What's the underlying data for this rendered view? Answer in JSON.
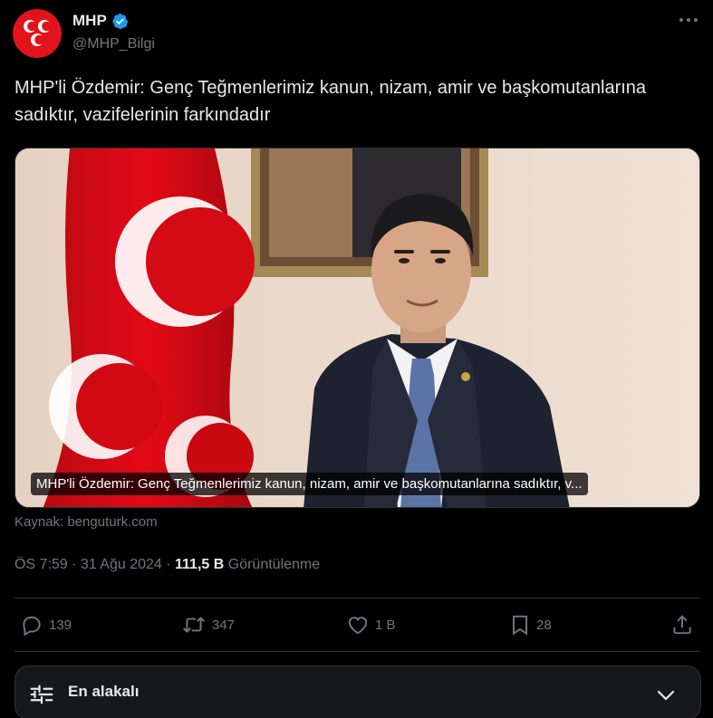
{
  "author": {
    "name": "MHP",
    "handle": "@MHP_Bilgi",
    "verified": true,
    "avatar_icon": "mhp-logo-icon",
    "brand_color": "#e3131b"
  },
  "tweet": {
    "text": "MHP'li Özdemir: Genç Teğmenlerimiz kanun, nizam, amir ve başkomutanlarına sadıktır, vazifelerinin farkındadır",
    "media_caption": "MHP'li Özdemir: Genç Teğmenlerimiz kanun, nizam, amir ve başkomutanlarına sadıktır, v...",
    "source": "Kaynak: benguturk.com",
    "time": "ÖS 7:59",
    "separator": " · ",
    "date": "31 Ağu 2024",
    "views_count": "111,5 B",
    "views_label": "Görüntülenme"
  },
  "actions": {
    "replies": "139",
    "reposts": "347",
    "likes": "1 B",
    "bookmarks": "28"
  },
  "sort": {
    "label": "En alakalı"
  },
  "colors": {
    "background": "#000000",
    "text_primary": "#e7e9ea",
    "text_secondary": "#71767b",
    "divider": "#2f3336",
    "verified_blue": "#1d9bf0",
    "flag_red": "#e30a17"
  }
}
